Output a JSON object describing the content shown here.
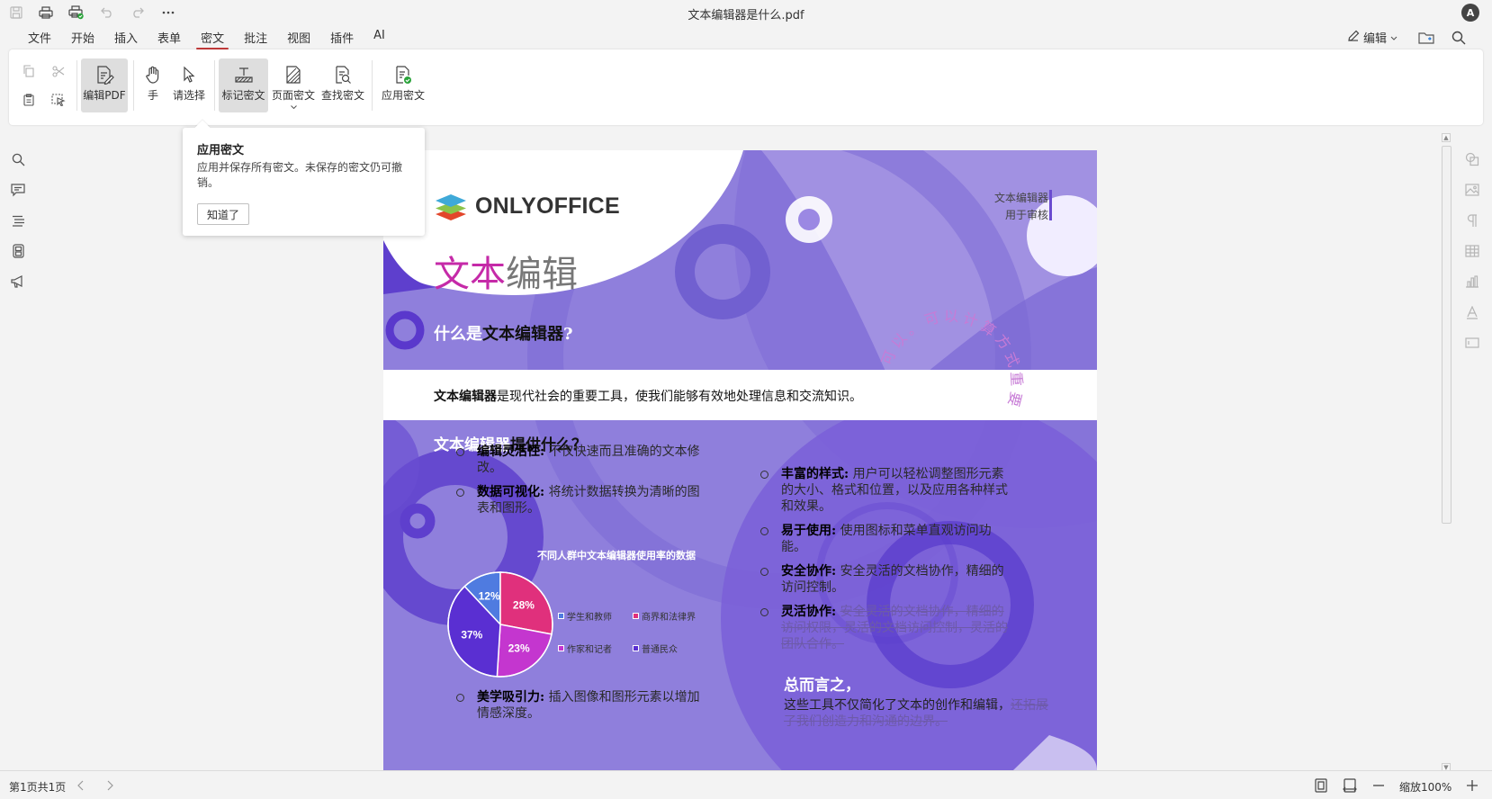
{
  "window": {
    "title": "文本编辑器是什么.pdf",
    "avatar": "A"
  },
  "quick_access": [
    {
      "name": "save-icon"
    },
    {
      "name": "print-icon"
    },
    {
      "name": "quick-print-icon"
    },
    {
      "name": "undo-icon"
    },
    {
      "name": "redo-icon"
    },
    {
      "name": "more-icon"
    }
  ],
  "menu": {
    "tabs": [
      {
        "label": "文件"
      },
      {
        "label": "开始"
      },
      {
        "label": "插入"
      },
      {
        "label": "表单"
      },
      {
        "label": "密文"
      },
      {
        "label": "批注"
      },
      {
        "label": "视图"
      },
      {
        "label": "插件"
      },
      {
        "label": "AI"
      }
    ],
    "active_tab": "密文",
    "edit_mode": "编辑"
  },
  "toolbar": {
    "edit_pdf": "编辑PDF",
    "hand": "手",
    "select": "请选择",
    "mark_redaction": "标记密文",
    "page_redaction": "页面密文",
    "find_redaction": "查找密文",
    "apply_redaction": "应用密文"
  },
  "popover": {
    "title": "应用密文",
    "body": "应用并保存所有密文。未保存的密文仍可撤销。",
    "button": "知道了"
  },
  "document": {
    "logo": "ONLYOFFICE",
    "header_right_1": "文本编辑器",
    "header_right_2": "用于审核",
    "big_title_a": "文本",
    "big_title_b": "编辑",
    "what_a": "什么是",
    "what_b": "文本编辑器",
    "what_c": "?",
    "band_bold": "文本编辑器",
    "band_text": "是现代社会的重要工具，使我们能够有效地处理信息和交流知识。",
    "offer_a": "文本编辑器",
    "offer_b": "提供什么？",
    "bullets_left": [
      {
        "bold": "编辑灵活性:",
        "text": " 不仅快速而且准确的文本修改。"
      },
      {
        "bold": "数据可视化:",
        "text": " 将统计数据转换为清晰的图表和图形。"
      },
      {
        "bold": "美学吸引力:",
        "text": " 插入图像和图形元素以增加情感深度。"
      }
    ],
    "bullets_right": [
      {
        "bold": "丰富的样式:",
        "text": " 用户可以轻松调整图形元素的大小、格式和位置，以及应用各种样式和效果。"
      },
      {
        "bold": "易于使用:",
        "text": " 使用图标和菜单直观访问功能。"
      },
      {
        "bold": "安全协作:",
        "text": " 安全灵活的文档协作，精细的访问控制。"
      },
      {
        "bold": "灵活协作:",
        "text": " ",
        "strike": "安全灵活的文档协作，精细的访问权限，灵活的文档访问控制，灵活的团队合作。"
      }
    ],
    "summary_title": "总而言之，",
    "summary_text": "这些工具不仅简化了文本的创作和编辑，",
    "summary_strike": "还拓展了我们创造力和沟通的边界。",
    "curve_text": [
      "可",
      "以",
      "。",
      "可",
      "以",
      "计",
      "算",
      "方",
      "式",
      "重",
      "要"
    ]
  },
  "chart_data": {
    "type": "pie",
    "title": "不同人群中文本编辑器使用率的数据",
    "categories": [
      "学生和教师",
      "商界和法律界",
      "作家和记者",
      "普通民众"
    ],
    "values": [
      12,
      28,
      23,
      37
    ],
    "labels": [
      "12%",
      "28%",
      "23%",
      "37%"
    ],
    "colors": [
      "#4f7be0",
      "#e0307c",
      "#c436cf",
      "#5a2fd2"
    ],
    "legend_position": "right"
  },
  "statusbar": {
    "page_info": "第1页共1页",
    "zoom": "缩放100%"
  }
}
